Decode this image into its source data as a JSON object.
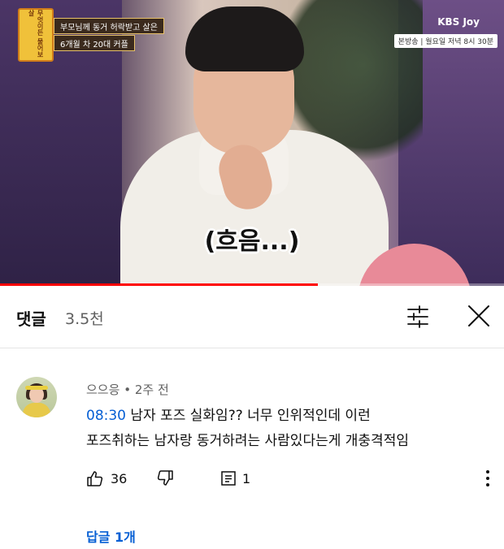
{
  "video": {
    "show_logo_text": "무엇이든 물어보살",
    "caption_line1": "부모님께 동거 허락받고 살은",
    "caption_line2": "6개월 차 20대 커플",
    "channel_logo": "KBS Joy",
    "schedule": "본방송 | 월요일 저녁 8시 30분",
    "subtitle": "(흐음...)",
    "progress_fraction": 0.63,
    "progress_color": "#ff0000"
  },
  "comments_panel": {
    "title": "댓글",
    "count": "3.5천",
    "filter_icon": "sliders-icon",
    "close_icon": "close-icon"
  },
  "comment": {
    "author": "으으응",
    "separator": "•",
    "time": "2주 전",
    "timestamp": "08:30",
    "text_line1": " 남자 포즈 실화임?? 너무 인위적인데 이런",
    "text_line2": "포즈취하는 남자랑 동거하려는 사람있다는게 개충격적임",
    "likes": "36",
    "replies_count": "1",
    "replies_link": "답글 1개",
    "link_color": "#065fd4"
  }
}
